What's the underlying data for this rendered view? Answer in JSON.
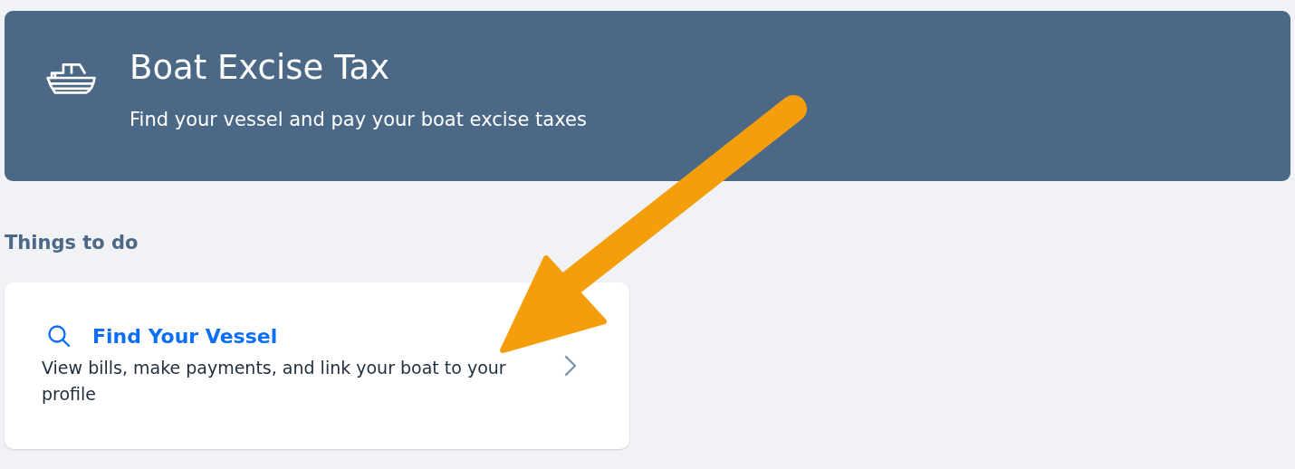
{
  "banner": {
    "title": "Boat Excise Tax",
    "subtitle": "Find your vessel and pay your boat excise taxes"
  },
  "section": {
    "heading": "Things to do"
  },
  "cards": [
    {
      "title": "Find Your Vessel",
      "description": "View bills, make payments, and link your boat to your profile"
    }
  ]
}
